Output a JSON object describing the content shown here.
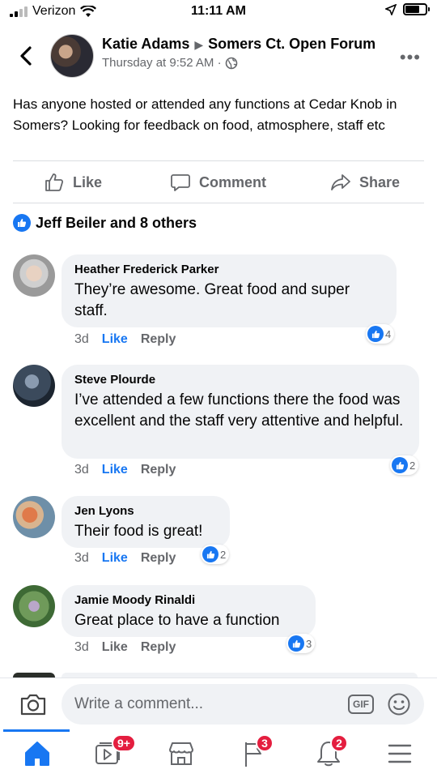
{
  "status_bar": {
    "carrier": "Verizon",
    "time": "11:11 AM"
  },
  "post": {
    "author": "Katie Adams",
    "group": "Somers Ct. Open Forum",
    "timestamp": "Thursday at 9:52 AM ·",
    "text": "Has anyone hosted or attended any functions at Cedar Knob in Somers? Looking for feedback on food, atmosphere, staff etc",
    "reactions_summary": "Jeff Beiler and 8 others"
  },
  "actions": {
    "like": "Like",
    "comment": "Comment",
    "share": "Share"
  },
  "comments": [
    {
      "name": "Heather Frederick Parker",
      "text": "They’re awesome.  Great food and super staff.",
      "age": "3d",
      "like_label": "Like",
      "reply_label": "Reply",
      "reaction_count": "4",
      "liked": true
    },
    {
      "name": "Steve Plourde",
      "text": "I’ve attended a few functions there the food was excellent and the staff very attentive and helpful.",
      "age": "3d",
      "like_label": "Like",
      "reply_label": "Reply",
      "reaction_count": "2",
      "liked": true
    },
    {
      "name": "Jen Lyons",
      "text": "Their food is great!",
      "age": "3d",
      "like_label": "Like",
      "reply_label": "Reply",
      "reaction_count": "2",
      "liked": true
    },
    {
      "name": "Jamie Moody Rinaldi",
      "text": "Great place to have a function",
      "age": "3d",
      "like_label": "Like",
      "reply_label": "Reply",
      "reaction_count": "3",
      "liked": false
    }
  ],
  "composer": {
    "placeholder": "Write a comment...",
    "gif_label": "GIF"
  },
  "tabbar": {
    "watch_badge": "9+",
    "requests_badge": "3",
    "notifications_badge": "2"
  },
  "colors": {
    "accent": "#1877f2",
    "badge": "#e41e3f",
    "bubble": "#f0f2f5",
    "muted_text": "#65676b"
  }
}
